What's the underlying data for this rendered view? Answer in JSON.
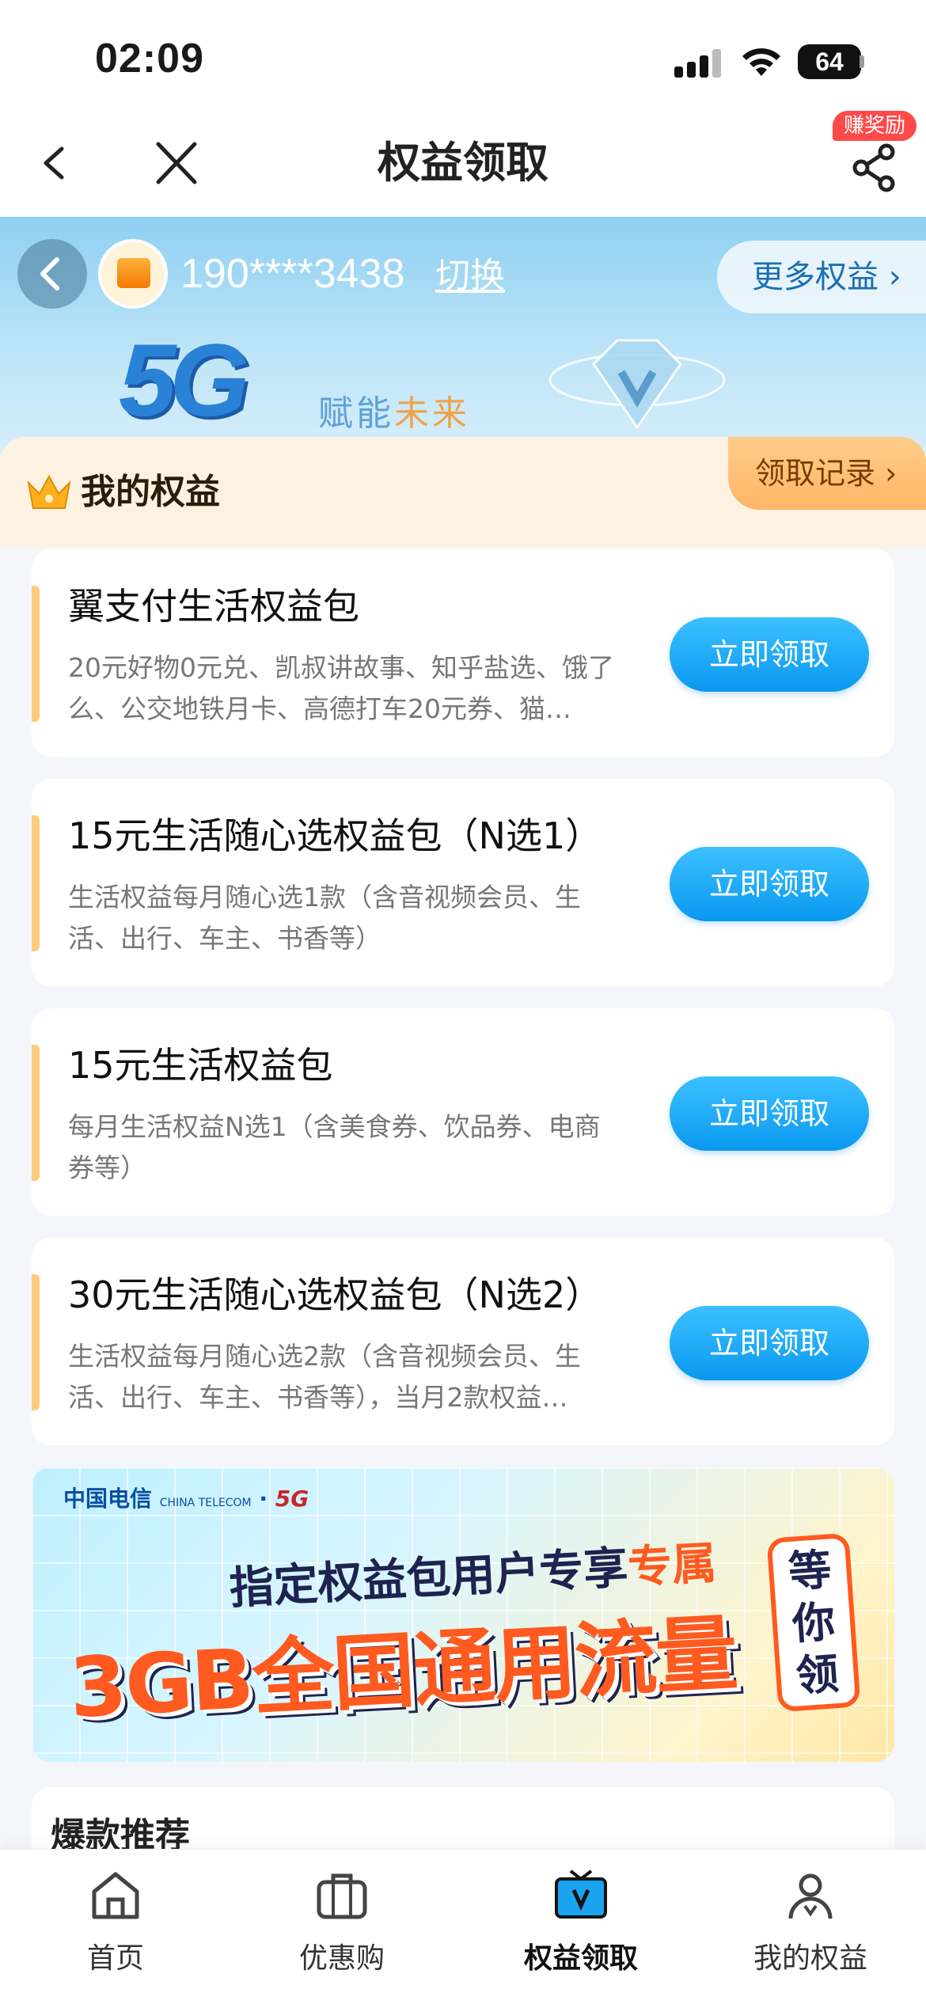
{
  "status_bar": {
    "time": "02:09",
    "battery": "64"
  },
  "nav": {
    "title": "权益领取",
    "reward_badge": "赚奖励"
  },
  "hero": {
    "phone": "190****3438",
    "switch_label": "切换",
    "more_rights": "更多权益 ›",
    "slogan_5g": "5G",
    "slogan_a": "赋能",
    "slogan_b": "未来"
  },
  "my_rights": {
    "title": "我的权益",
    "records_label": "领取记录 ›"
  },
  "packages": [
    {
      "title": "翼支付生活权益包",
      "desc": "20元好物0元兑、凯叔讲故事、知乎盐选、饿了么、公交地铁月卡、高德打车20元券、猫…",
      "button": "立即领取"
    },
    {
      "title": "15元生活随心选权益包（N选1）",
      "desc": "生活权益每月随心选1款（含音视频会员、生活、出行、车主、书香等）",
      "button": "立即领取"
    },
    {
      "title": "15元生活权益包",
      "desc": "每月生活权益N选1（含美食券、饮品券、电商券等）",
      "button": "立即领取"
    },
    {
      "title": "30元生活随心选权益包（N选2）",
      "desc": "生活权益每月随心选2款（含音视频会员、生活、出行、车主、书香等），当月2款权益…",
      "button": "立即领取"
    }
  ],
  "promo": {
    "logo": "中国电信",
    "logo_sub": "CHINA TELECOM",
    "logo_5g": "5G",
    "line1_a": "指定权益包用户专享",
    "line1_b": "专属",
    "line2": "3GB全国通用流量",
    "stamp": "等你领"
  },
  "hot": {
    "title": "爆款推荐"
  },
  "tabs": [
    {
      "label": "首页",
      "icon": "home-icon"
    },
    {
      "label": "优惠购",
      "icon": "briefcase-icon"
    },
    {
      "label": "权益领取",
      "icon": "tv-v-icon",
      "active": true
    },
    {
      "label": "我的权益",
      "icon": "person-icon"
    }
  ],
  "colors": {
    "accent": "#0a98f0",
    "card_bar": "#ffcc7e",
    "promo_orange": "#ff5a1f"
  }
}
